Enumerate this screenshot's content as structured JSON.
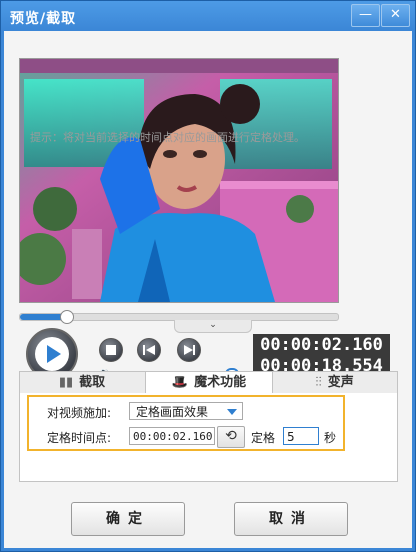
{
  "window": {
    "title": "预览/截取",
    "minimize_glyph": "—",
    "close_glyph": "✕"
  },
  "player": {
    "current_time": "00:00:02.160",
    "total_time": "00:00:18.554",
    "seek_progress": 0.145,
    "volume_level": 0.95,
    "controls": [
      "play-icon",
      "stop-icon",
      "prev-frame-icon",
      "next-frame-icon",
      "volume-icon"
    ]
  },
  "tabs": [
    {
      "label": "截取",
      "icon": "film-cut-icon"
    },
    {
      "label": "魔术功能",
      "icon": "magic-hat-icon",
      "active": true
    },
    {
      "label": "变声",
      "icon": "audio-wave-icon"
    }
  ],
  "magic": {
    "apply_label": "对视频施加:",
    "effect_value": "定格画面效果",
    "freeze_time_label": "定格时间点:",
    "freeze_time_value": "00:00:02.160",
    "freeze_label": "定格",
    "freeze_seconds": "5",
    "seconds_unit": "秒"
  },
  "hint": "提示：将对当前选择的时间点对应的画面进行定格处理。",
  "buttons": {
    "ok": "确定",
    "cancel": "取消"
  },
  "colors": {
    "accent": "#2f7fd0",
    "highlight_border": "#f2b32c",
    "timecode_bg": "#3a3a3a"
  }
}
